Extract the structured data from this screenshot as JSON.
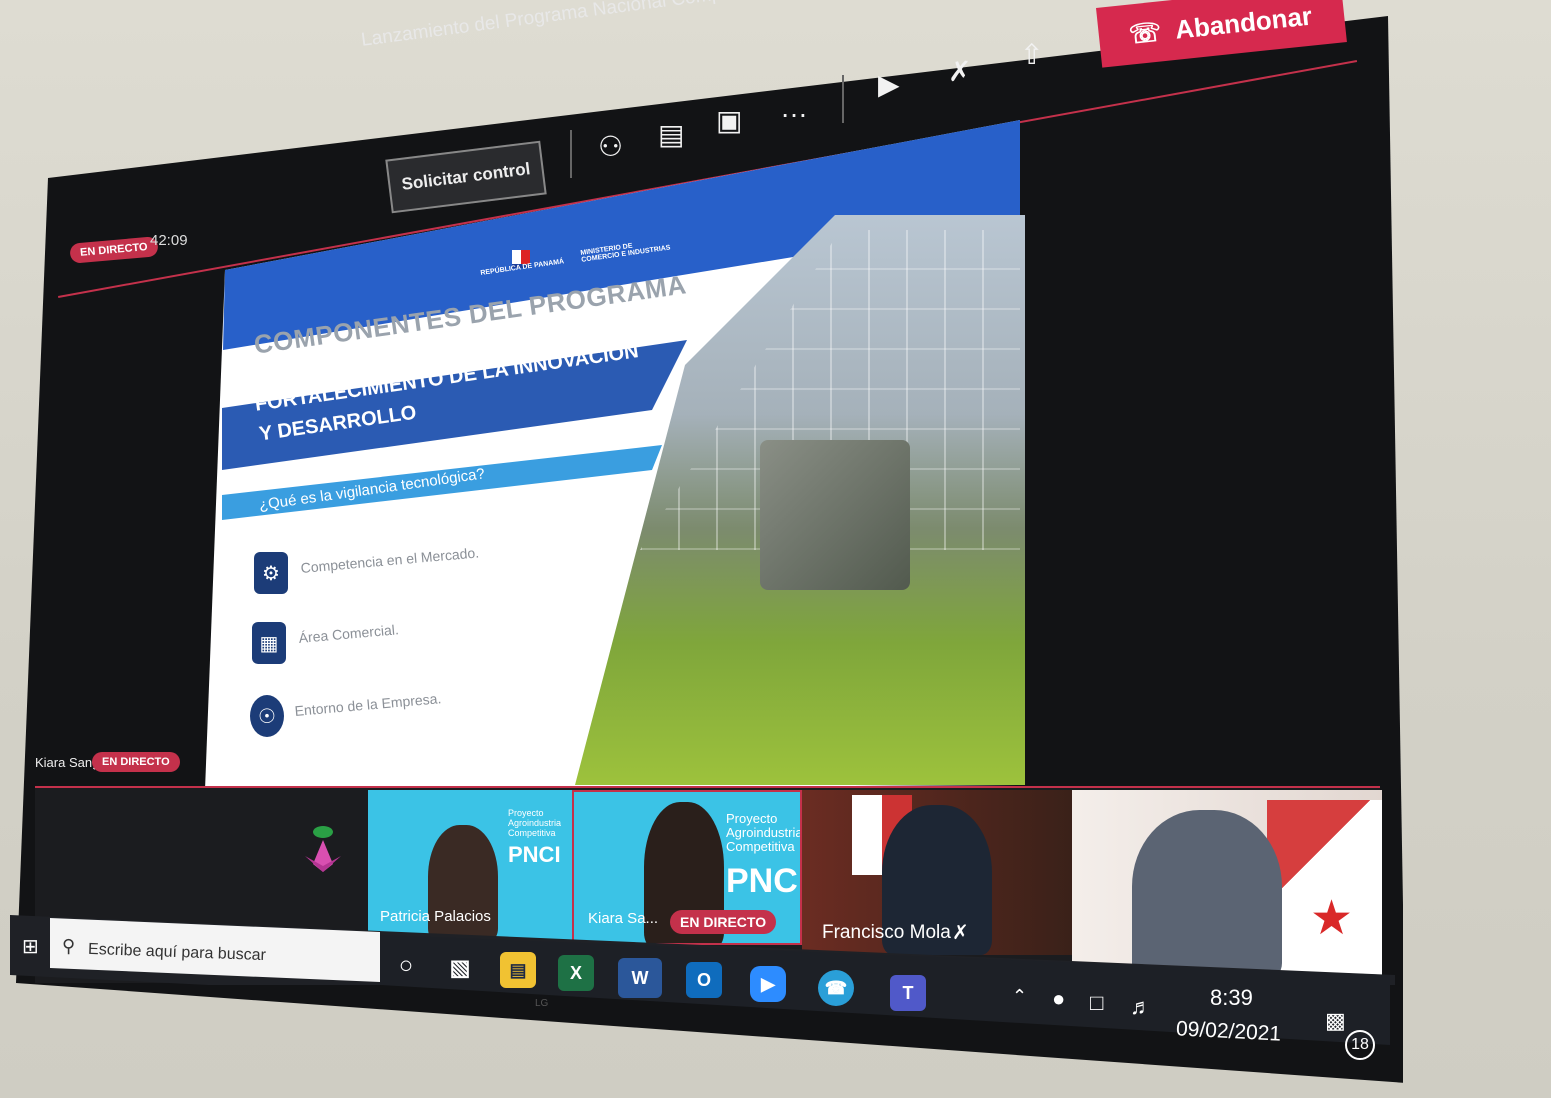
{
  "meeting": {
    "title": "Lanzamiento del Programa Nacional Competitividad Industrial",
    "request_control": "Solicitar control",
    "leave": "Abandonar",
    "live": "EN DIRECTO",
    "elapsed": "42:09",
    "presenter": "Kiara Sang"
  },
  "toolbar_icons": [
    "participants-icon",
    "chat-icon",
    "reactions-icon",
    "more-icon",
    "camera-icon",
    "mic-off-icon",
    "share-icon",
    "phone-icon"
  ],
  "slide": {
    "ministry": "MINISTERIO DE COMERCIO E INDUSTRIAS",
    "republic": "REPÚBLICA DE PANAMÁ",
    "heading": "COMPONENTES DEL PROGRAMA",
    "subheading_line1": "FORTALECIMIENTO DE LA INNOVACIÓN",
    "subheading_line2": "Y DESARROLLO",
    "question": "¿Qué es la vigilancia tecnológica?",
    "items": [
      {
        "label": "Competencia en el Mercado.",
        "icon": "market-icon"
      },
      {
        "label": "Área Comercial.",
        "icon": "commerce-icon"
      },
      {
        "label": "Entorno de la Empresa.",
        "icon": "company-icon"
      }
    ]
  },
  "participants": [
    {
      "name": "Patricia Palacios",
      "banner_small": "Proyecto Agroindustria Competitiva",
      "banner_big": "PNCI"
    },
    {
      "name": "Kiara Sa...",
      "banner_small": "Proyecto Agroindustrial Competitiva",
      "banner_big": "PNCI",
      "badge": "EN DIRECTO"
    },
    {
      "name": "Francisco Mola"
    },
    {
      "name": ""
    }
  ],
  "taskbar": {
    "search_placeholder": "Escribe aquí para buscar",
    "time": "8:39",
    "date": "09/02/2021",
    "notifications": "18",
    "apps": [
      "cortana-icon",
      "task-view-icon",
      "file-explorer-icon",
      "excel-icon",
      "word-icon",
      "outlook-icon",
      "zoom-icon",
      "chat-app-icon",
      "teams-icon"
    ]
  },
  "colors": {
    "accent_red": "#c4314b",
    "slide_blue": "#2860c9",
    "teams_live": "#d6294e"
  }
}
